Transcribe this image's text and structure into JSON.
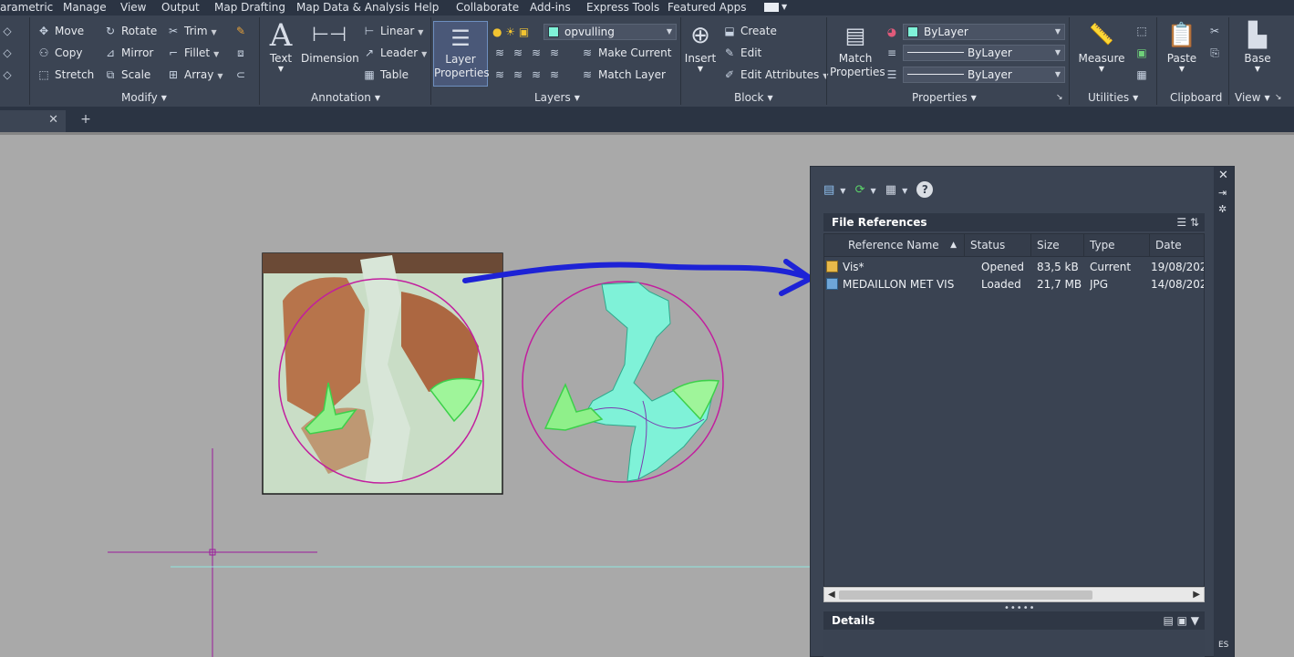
{
  "menubar": {
    "items": [
      "arametric",
      "Manage",
      "View",
      "Output",
      "Map Drafting",
      "Map Data & Analysis",
      "Help",
      "Collaborate",
      "Add-ins",
      "Express Tools",
      "Featured Apps"
    ]
  },
  "ribbon": {
    "modify": {
      "title": "Modify",
      "move": "Move",
      "copy": "Copy",
      "stretch": "Stretch",
      "rotate": "Rotate",
      "mirror": "Mirror",
      "scale": "Scale",
      "trim": "Trim",
      "fillet": "Fillet",
      "array": "Array"
    },
    "annotation": {
      "title": "Annotation",
      "text": "Text",
      "dimension": "Dimension",
      "linear": "Linear",
      "leader": "Leader",
      "table": "Table"
    },
    "layers": {
      "title": "Layers",
      "layer_properties": "Layer Properties",
      "current_layer": "opvulling",
      "make_current": "Make Current",
      "match_layer": "Match Layer",
      "layer_color": "#7ff2d8"
    },
    "block": {
      "title": "Block",
      "insert": "Insert",
      "create": "Create",
      "edit": "Edit",
      "edit_attributes": "Edit Attributes"
    },
    "properties": {
      "title": "Properties",
      "match_properties": "Match Properties",
      "color": "ByLayer",
      "linetype": "ByLayer",
      "lineweight": "ByLayer"
    },
    "utilities": {
      "title": "Utilities",
      "measure": "Measure"
    },
    "clipboard": {
      "title": "Clipboard",
      "paste": "Paste"
    },
    "view": {
      "title": "View",
      "base": "Base"
    }
  },
  "file_references": {
    "section_title": "File References",
    "columns": [
      "Reference Name",
      "Status",
      "Size",
      "Type",
      "Date"
    ],
    "rows": [
      {
        "name": "Vis*",
        "status": "Opened",
        "size": "83,5 kB",
        "type": "Current",
        "date": "19/08/202..."
      },
      {
        "name": "MEDAILLON MET VIS",
        "status": "Loaded",
        "size": "21,7 MB",
        "type": "JPG",
        "date": "14/08/202..."
      }
    ],
    "details_title": "Details"
  },
  "colors": {
    "ribbon_bg": "#3b4453",
    "canvas_bg": "#a9a9a9",
    "layer_magenta": "#c21e9e",
    "fill_cyan": "#7ff2d8",
    "arrow_blue": "#1d22d6"
  }
}
